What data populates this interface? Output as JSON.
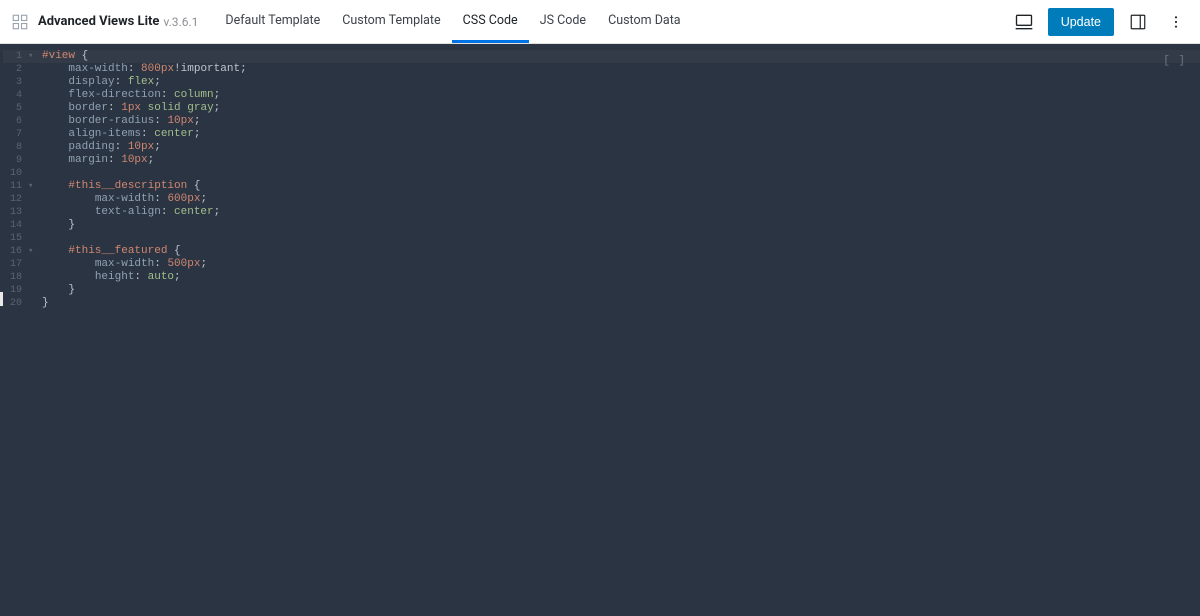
{
  "header": {
    "app_title": "Advanced Views Lite",
    "version": "v.3.6.1",
    "update_button": "Update"
  },
  "tabs": [
    {
      "label": "Default Template",
      "active": false
    },
    {
      "label": "Custom Template",
      "active": false
    },
    {
      "label": "CSS Code",
      "active": true
    },
    {
      "label": "JS Code",
      "active": false
    },
    {
      "label": "Custom Data",
      "active": false
    }
  ],
  "editor": {
    "expand_label": "[ ]",
    "lines": [
      {
        "n": 1,
        "fold": "▾",
        "active": true,
        "indent": 0,
        "tokens": [
          [
            "sel",
            "#view"
          ],
          [
            "punc",
            " {"
          ]
        ]
      },
      {
        "n": 2,
        "fold": "",
        "indent": 1,
        "tokens": [
          [
            "prop",
            "max-width"
          ],
          [
            "punc",
            ": "
          ],
          [
            "num",
            "800"
          ],
          [
            "unit",
            "px"
          ],
          [
            "imp",
            "!important"
          ],
          [
            "punc",
            ";"
          ]
        ]
      },
      {
        "n": 3,
        "fold": "",
        "indent": 1,
        "tokens": [
          [
            "prop",
            "display"
          ],
          [
            "punc",
            ": "
          ],
          [
            "val",
            "flex"
          ],
          [
            "punc",
            ";"
          ]
        ]
      },
      {
        "n": 4,
        "fold": "",
        "indent": 1,
        "tokens": [
          [
            "prop",
            "flex-direction"
          ],
          [
            "punc",
            ": "
          ],
          [
            "val",
            "column"
          ],
          [
            "punc",
            ";"
          ]
        ]
      },
      {
        "n": 5,
        "fold": "",
        "indent": 1,
        "tokens": [
          [
            "prop",
            "border"
          ],
          [
            "punc",
            ": "
          ],
          [
            "num",
            "1"
          ],
          [
            "unit",
            "px"
          ],
          [
            "punc",
            " "
          ],
          [
            "val",
            "solid"
          ],
          [
            "punc",
            " "
          ],
          [
            "val",
            "gray"
          ],
          [
            "punc",
            ";"
          ]
        ]
      },
      {
        "n": 6,
        "fold": "",
        "indent": 1,
        "tokens": [
          [
            "prop",
            "border-radius"
          ],
          [
            "punc",
            ": "
          ],
          [
            "num",
            "10"
          ],
          [
            "unit",
            "px"
          ],
          [
            "punc",
            ";"
          ]
        ]
      },
      {
        "n": 7,
        "fold": "",
        "indent": 1,
        "tokens": [
          [
            "prop",
            "align-items"
          ],
          [
            "punc",
            ": "
          ],
          [
            "val",
            "center"
          ],
          [
            "punc",
            ";"
          ]
        ]
      },
      {
        "n": 8,
        "fold": "",
        "indent": 1,
        "tokens": [
          [
            "prop",
            "padding"
          ],
          [
            "punc",
            ": "
          ],
          [
            "num",
            "10"
          ],
          [
            "unit",
            "px"
          ],
          [
            "punc",
            ";"
          ]
        ]
      },
      {
        "n": 9,
        "fold": "",
        "indent": 1,
        "tokens": [
          [
            "prop",
            "margin"
          ],
          [
            "punc",
            ": "
          ],
          [
            "num",
            "10"
          ],
          [
            "unit",
            "px"
          ],
          [
            "punc",
            ";"
          ]
        ]
      },
      {
        "n": 10,
        "fold": "",
        "indent": 1,
        "tokens": []
      },
      {
        "n": 11,
        "fold": "▾",
        "indent": 1,
        "tokens": [
          [
            "sel",
            "#this__description"
          ],
          [
            "punc",
            " {"
          ]
        ]
      },
      {
        "n": 12,
        "fold": "",
        "indent": 2,
        "tokens": [
          [
            "prop",
            "max-width"
          ],
          [
            "punc",
            ": "
          ],
          [
            "num",
            "600"
          ],
          [
            "unit",
            "px"
          ],
          [
            "punc",
            ";"
          ]
        ]
      },
      {
        "n": 13,
        "fold": "",
        "indent": 2,
        "tokens": [
          [
            "prop",
            "text-align"
          ],
          [
            "punc",
            ": "
          ],
          [
            "val",
            "center"
          ],
          [
            "punc",
            ";"
          ]
        ]
      },
      {
        "n": 14,
        "fold": "",
        "indent": 1,
        "tokens": [
          [
            "punc",
            "}"
          ]
        ]
      },
      {
        "n": 15,
        "fold": "",
        "indent": 1,
        "tokens": []
      },
      {
        "n": 16,
        "fold": "▾",
        "indent": 1,
        "tokens": [
          [
            "sel",
            "#this__featured"
          ],
          [
            "punc",
            " {"
          ]
        ]
      },
      {
        "n": 17,
        "fold": "",
        "indent": 2,
        "tokens": [
          [
            "prop",
            "max-width"
          ],
          [
            "punc",
            ": "
          ],
          [
            "num",
            "500"
          ],
          [
            "unit",
            "px"
          ],
          [
            "punc",
            ";"
          ]
        ]
      },
      {
        "n": 18,
        "fold": "",
        "indent": 2,
        "tokens": [
          [
            "prop",
            "height"
          ],
          [
            "punc",
            ": "
          ],
          [
            "val",
            "auto"
          ],
          [
            "punc",
            ";"
          ]
        ]
      },
      {
        "n": 19,
        "fold": "",
        "indent": 1,
        "tokens": [
          [
            "punc",
            "}"
          ]
        ]
      },
      {
        "n": 20,
        "fold": "",
        "indent": 0,
        "tokens": [
          [
            "punc",
            "}"
          ]
        ]
      }
    ]
  }
}
